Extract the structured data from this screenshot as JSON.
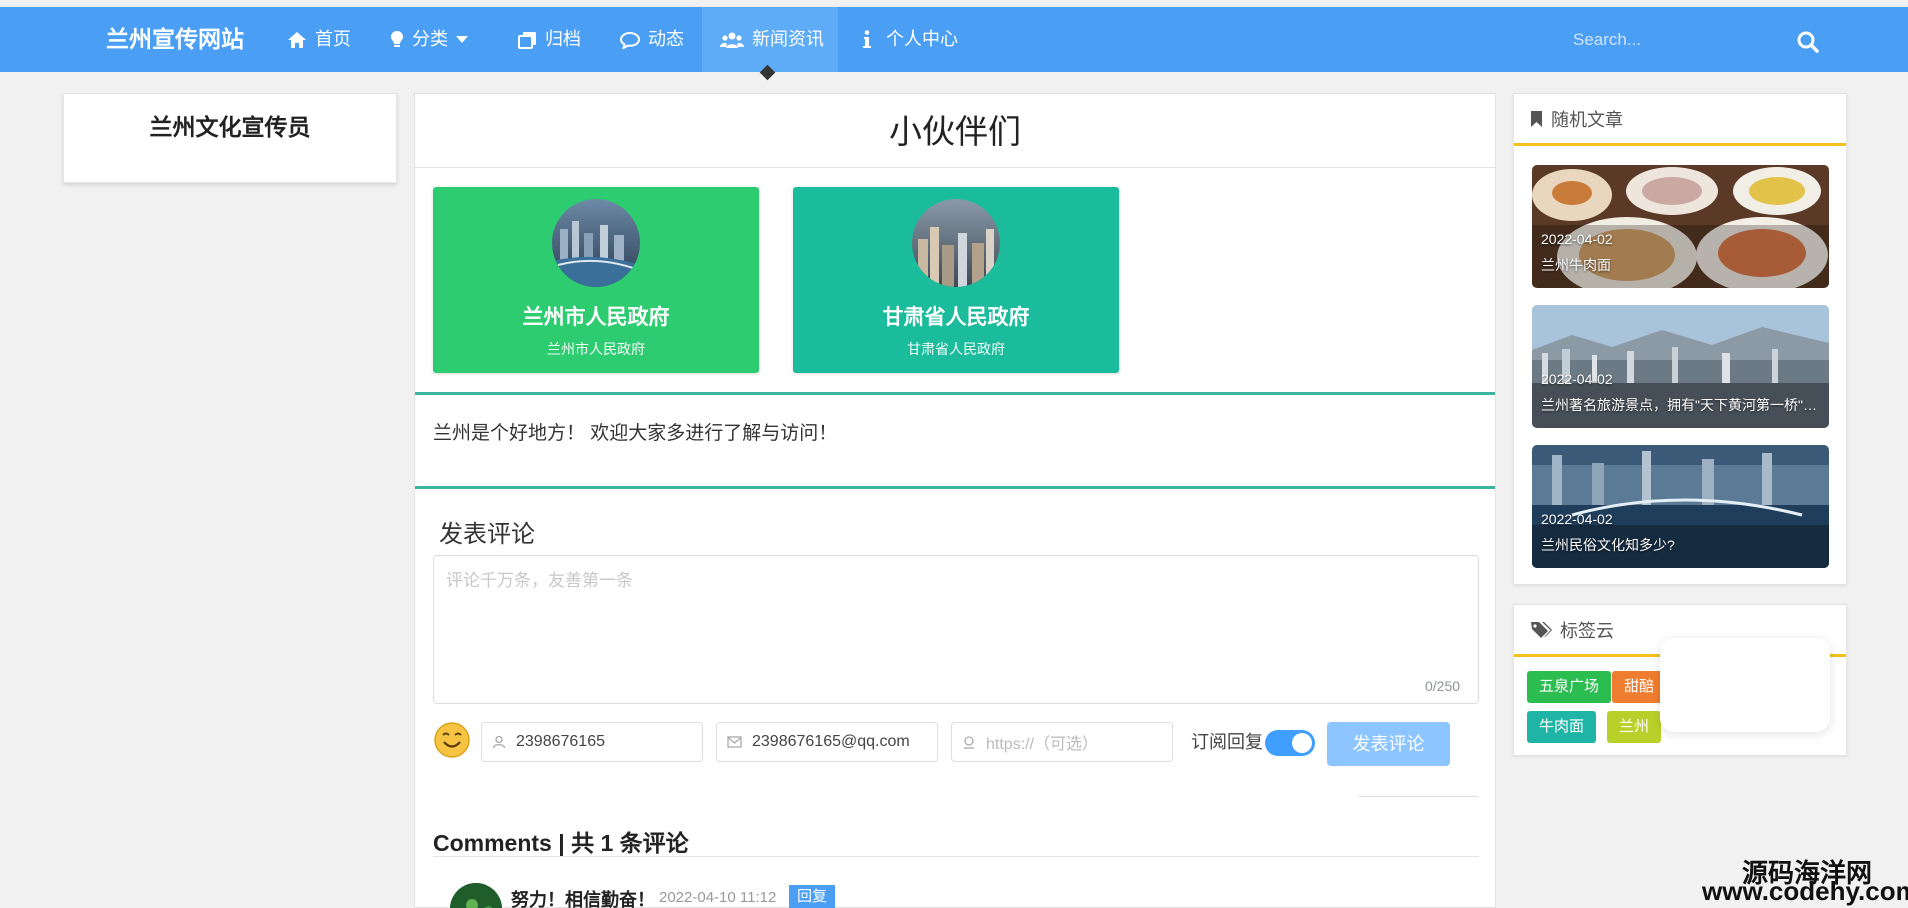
{
  "nav": {
    "brand": "兰州宣传网站",
    "items": [
      {
        "label": "首页",
        "icon": "home-icon"
      },
      {
        "label": "分类",
        "icon": "lightbulb-icon"
      },
      {
        "label": "归档",
        "icon": "archive-icon"
      },
      {
        "label": "动态",
        "icon": "comment-icon"
      },
      {
        "label": "新闻资讯",
        "icon": "users-icon"
      },
      {
        "label": "个人中心",
        "icon": "info-icon"
      }
    ],
    "search_placeholder": "Search..."
  },
  "left": {
    "card_title": "兰州文化宣传员"
  },
  "main": {
    "title": "小伙伴们",
    "partners": [
      {
        "name": "兰州市人民政府",
        "desc": "兰州市人民政府",
        "color": "#2ecc71"
      },
      {
        "name": "甘肃省人民政府",
        "desc": "甘肃省人民政府",
        "color": "#1abc9c"
      }
    ],
    "intro": "兰州是个好地方！ 欢迎大家多进行了解与访问！",
    "comment_form": {
      "heading": "发表评论",
      "placeholder": "评论千万条，友善第一条",
      "counter": "0/250",
      "nickname": "2398676165",
      "email": "2398676165@qq.com",
      "url_placeholder": "https://（可选）",
      "subscribe_label": "订阅回复",
      "subscribe_on": true,
      "submit_label": "发表评论"
    },
    "comments_title": "Comments | 共 1 条评论",
    "comments": [
      {
        "name": "努力！相信勤奋！",
        "date": "2022-04-10 11:12",
        "reply_label": "回复"
      }
    ]
  },
  "right": {
    "random_title": "随机文章",
    "articles": [
      {
        "date": "2022-04-02",
        "title": "兰州牛肉面"
      },
      {
        "date": "2022-04-02",
        "title": "兰州著名旅游景点，拥有\"天下黄河第一桥\"之称"
      },
      {
        "date": "2022-04-02",
        "title": "兰州民俗文化知多少?"
      }
    ],
    "tags_title": "标签云",
    "tags": [
      {
        "label": "五泉广场",
        "color": "#2bbd4f"
      },
      {
        "label": "甜醅",
        "color": "#ef7d2f"
      },
      {
        "label": "牛肉面",
        "color": "#1fb5a6"
      },
      {
        "label": "兰州",
        "color": "#b8d12a"
      }
    ]
  },
  "watermark": {
    "line1": "源码海洋网",
    "line2": "www.codehy.com"
  }
}
